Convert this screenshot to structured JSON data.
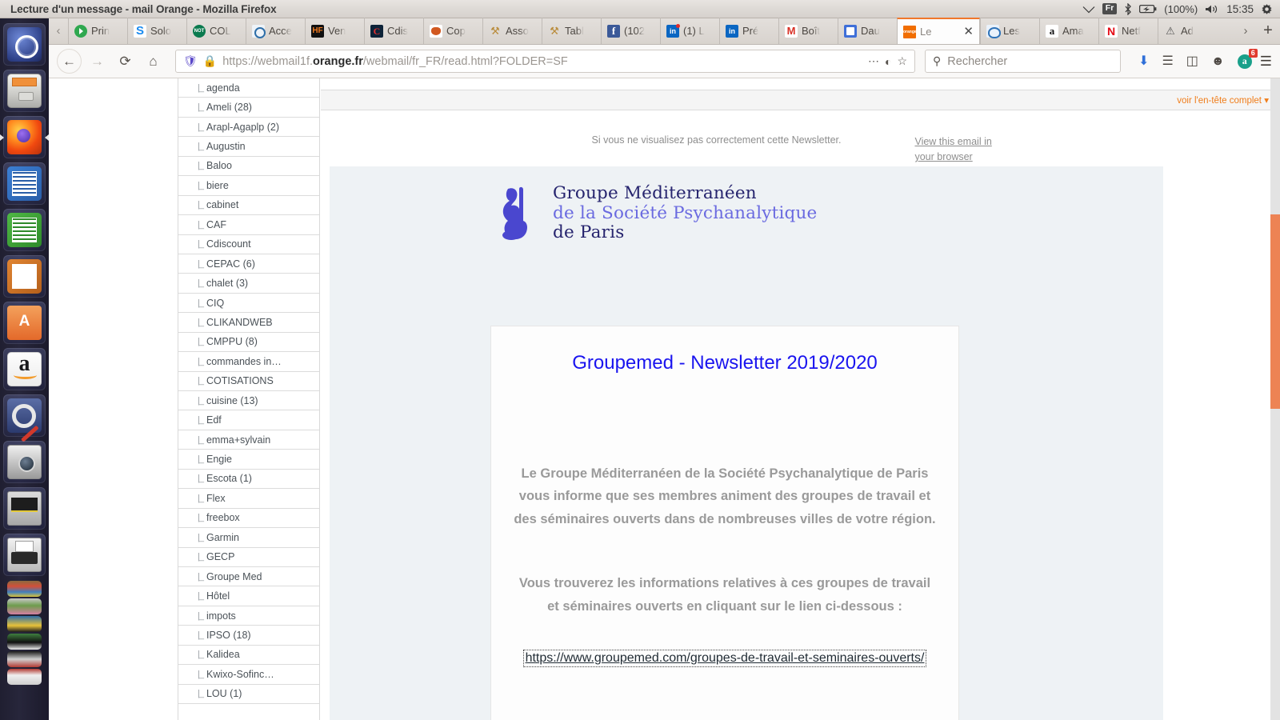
{
  "window": {
    "title": "Lecture d'un message - mail Orange - Mozilla Firefox"
  },
  "tray": {
    "wifi_icon": "wifi-icon",
    "keyboard_layout": "Fr",
    "bluetooth_icon": "bluetooth-icon",
    "battery_icon": "battery-icon",
    "battery_level": "(100%)",
    "volume_icon": "volume-icon",
    "clock": "15:35",
    "settings_icon": "gear-icon"
  },
  "launcher": {
    "items": [
      {
        "name": "ubuntu-dash",
        "icon": "ubuntu-logo-icon"
      },
      {
        "name": "files",
        "icon": "file-manager-icon"
      },
      {
        "name": "firefox",
        "icon": "firefox-icon",
        "running": true
      },
      {
        "name": "libreoffice-writer",
        "icon": "writer-icon"
      },
      {
        "name": "libreoffice-calc",
        "icon": "calc-icon"
      },
      {
        "name": "libreoffice-impress",
        "icon": "impress-icon"
      },
      {
        "name": "ubuntu-software",
        "icon": "software-center-icon"
      },
      {
        "name": "amazon",
        "icon": "amazon-icon"
      },
      {
        "name": "system-settings",
        "icon": "tools-icon"
      },
      {
        "name": "camera",
        "icon": "camera-icon"
      },
      {
        "name": "scanner",
        "icon": "scanner-icon"
      },
      {
        "name": "printer",
        "icon": "printer-icon"
      },
      {
        "name": "stack-1",
        "icon": "stacked-window-icon"
      },
      {
        "name": "stack-2",
        "icon": "stacked-window-icon"
      },
      {
        "name": "stack-3",
        "icon": "stacked-window-icon"
      },
      {
        "name": "stack-4",
        "icon": "stacked-window-icon"
      },
      {
        "name": "stack-5",
        "icon": "stacked-window-icon"
      },
      {
        "name": "stack-6",
        "icon": "stacked-window-icon"
      }
    ]
  },
  "tabs": {
    "scroll_left_icon": "chevron-left-icon",
    "overflow_icon": "chevron-right-icon",
    "new_tab_icon": "plus-icon",
    "close_icon": "close-icon",
    "items": [
      {
        "label": "Prin",
        "favicon": "play-icon",
        "active": false
      },
      {
        "label": "Solo",
        "favicon": "solo-s-icon",
        "active": false
      },
      {
        "label": "COL",
        "favicon": "col-badge-icon",
        "active": false
      },
      {
        "label": "Acce",
        "favicon": "accueil-icon",
        "active": false
      },
      {
        "label": "Ven",
        "favicon": "hf-icon",
        "active": false
      },
      {
        "label": "Cdis",
        "favicon": "cdiscount-icon",
        "active": false
      },
      {
        "label": "Cop",
        "favicon": "copain-icon",
        "active": false
      },
      {
        "label": "Asso",
        "favicon": "gavel-icon",
        "active": false
      },
      {
        "label": "Tabl",
        "favicon": "gavel-icon",
        "active": false
      },
      {
        "label": "(102",
        "favicon": "facebook-icon",
        "active": false
      },
      {
        "label": "(1) L",
        "favicon": "linkedin-icon",
        "active": false
      },
      {
        "label": "Pré",
        "favicon": "linkedin-icon",
        "active": false
      },
      {
        "label": "Boît",
        "favicon": "gmail-icon",
        "active": false
      },
      {
        "label": "Dau",
        "favicon": "dauphine-icon",
        "active": false
      },
      {
        "label": "Le",
        "favicon": "orange-icon",
        "active": true
      },
      {
        "label": "Les",
        "favicon": "leboncoin-icon",
        "active": false
      },
      {
        "label": "Ama",
        "favicon": "amazon-icon",
        "active": false
      },
      {
        "label": "Netf",
        "favicon": "netflix-icon",
        "active": false
      },
      {
        "label": "Ad",
        "favicon": "warning-icon",
        "active": false
      }
    ]
  },
  "navbar": {
    "back_icon": "back-arrow-icon",
    "forward_icon": "forward-arrow-icon",
    "reload_icon": "reload-icon",
    "home_icon": "home-icon",
    "shield_icon": "shield-icon",
    "lock_icon": "lock-icon",
    "url_prefix": "https://webmail1f.",
    "url_domain": "orange.fr",
    "url_suffix": "/webmail/fr_FR/read.html?FOLDER=SF",
    "page_actions_icon": "ellipsis-icon",
    "reader_icon": "reader-view-icon",
    "bookmark_icon": "star-icon",
    "search_icon": "search-icon",
    "search_placeholder": "Rechercher",
    "downloads_icon": "download-icon",
    "library_icon": "library-icon",
    "sidebar_icon": "sidebar-icon",
    "account_icon": "account-icon",
    "adblock_icon": "adblock-icon",
    "adblock_count": "6",
    "menu_icon": "hamburger-menu-icon"
  },
  "folders": [
    {
      "label": "agenda"
    },
    {
      "label": "Ameli (28)"
    },
    {
      "label": "Arapl-Agaplp (2)"
    },
    {
      "label": "Augustin"
    },
    {
      "label": "Baloo"
    },
    {
      "label": "biere"
    },
    {
      "label": "cabinet"
    },
    {
      "label": "CAF"
    },
    {
      "label": "Cdiscount"
    },
    {
      "label": "CEPAC (6)"
    },
    {
      "label": "chalet (3)"
    },
    {
      "label": "CIQ"
    },
    {
      "label": "CLIKANDWEB"
    },
    {
      "label": "CMPPU (8)"
    },
    {
      "label": "commandes in…"
    },
    {
      "label": "COTISATIONS"
    },
    {
      "label": "cuisine (13)"
    },
    {
      "label": "Edf"
    },
    {
      "label": "emma+sylvain"
    },
    {
      "label": "Engie"
    },
    {
      "label": "Escota (1)"
    },
    {
      "label": "Flex"
    },
    {
      "label": "freebox"
    },
    {
      "label": "Garmin"
    },
    {
      "label": "GECP"
    },
    {
      "label": "Groupe Med"
    },
    {
      "label": "Hôtel"
    },
    {
      "label": "impots"
    },
    {
      "label": "IPSO (18)"
    },
    {
      "label": "Kalidea"
    },
    {
      "label": "Kwixo-Sofinc…"
    },
    {
      "label": "LOU (1)"
    }
  ],
  "mail": {
    "header_toggle": "voir l'en-tête complet",
    "header_toggle_icon": "chevron-down-icon",
    "notice_text": "Si vous ne visualisez pas correctement cette Newsletter.",
    "notice_link": "View this email in your browser",
    "logo": {
      "icon": "groupemed-figure-icon",
      "line1": "Groupe Méditerranéen",
      "line2": "de la Société Psychanalytique",
      "line3": "de Paris",
      "color_dark": "#26246e",
      "color_light": "#6a6ae0"
    },
    "card": {
      "title": "Groupemed - Newsletter 2019/2020",
      "title_color": "#1a14ef",
      "paragraph1": "Le Groupe Méditerranéen de la Société Psychanalytique de Paris vous informe que ses membres animent des groupes de travail et des séminaires ouverts dans de nombreuses villes de votre région.",
      "paragraph2": "Vous trouverez les informations relatives à ces groupes de travail et séminaires ouverts en cliquant sur le lien ci-dessous :",
      "cta_link": "https://www.groupemed.com/groupes-de-travail-et-seminaires-ouverts/"
    }
  },
  "scrollbar": {
    "thumb_color": "#ed8354",
    "track_color": "#e3e3e3"
  }
}
